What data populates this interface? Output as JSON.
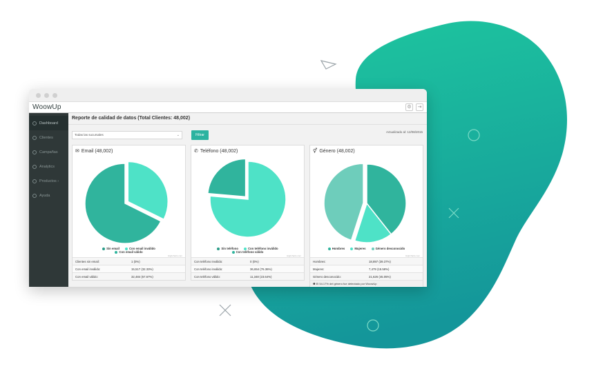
{
  "colors": {
    "teal_light": "#4ee2c7",
    "teal_mid": "#30b49d",
    "teal_pale": "#6ecdbb",
    "accent_button": "#2bb3a0",
    "sidebar_bg": "#2f3838",
    "blob_top": "#1ec79f",
    "blob_bottom": "#14969a"
  },
  "app": {
    "logo": "WoowUp"
  },
  "sidebar": {
    "items": [
      {
        "label": "Dashboard",
        "icon": "dashboard-icon"
      },
      {
        "label": "Clientes",
        "icon": "users-icon"
      },
      {
        "label": "Campañas",
        "icon": "megaphone-icon"
      },
      {
        "label": "Analytics",
        "icon": "analytics-icon"
      },
      {
        "label": "Productos ›",
        "icon": "products-icon"
      },
      {
        "label": "Ayuda",
        "icon": "help-icon"
      }
    ]
  },
  "page": {
    "title": "Reporte de calidad de datos (Total Clientes: 48,002)",
    "select_value": "Todas las sucursales",
    "filter_label": "Filtrar",
    "updated": "Actualizado al: 12/08/2015"
  },
  "panels": [
    {
      "title": "Email (48,002)",
      "icon": "envelope-icon",
      "icon_glyph": "✉",
      "legend": [
        "Sin email",
        "Con email inválido",
        "Con email válido"
      ],
      "rows": [
        {
          "label": "Clientes sin email:",
          "value": "1 (0%)"
        },
        {
          "label": "Con email inválido:",
          "value": "15,517 (32.33%)"
        },
        {
          "label": "Con email válido:",
          "value": "32,484 (67.67%)"
        }
      ],
      "credit": "Highcharts.com"
    },
    {
      "title": "Teléfono (48,002)",
      "icon": "phone-icon",
      "icon_glyph": "✆",
      "legend": [
        "Sin teléfono",
        "Con teléfono inválido",
        "Con teléfono válido"
      ],
      "rows": [
        {
          "label": "Con teléfono inválido:",
          "value": "0 (0%)"
        },
        {
          "label": "Con teléfono inválido:",
          "value": "36,654 (76.36%)"
        },
        {
          "label": "Con teléfono válido:",
          "value": "11,348 (23.64%)"
        }
      ],
      "credit": "Highcharts.com"
    },
    {
      "title": "Género (48,002)",
      "icon": "gender-icon",
      "icon_glyph": "⚥",
      "legend": [
        "Hombres",
        "Mujeres",
        "Género desconocido"
      ],
      "rows": [
        {
          "label": "Hombres:",
          "value": "18,897 (39.37%)"
        },
        {
          "label": "Mujeres:",
          "value": "7,479 (15.58%)"
        },
        {
          "label": "Género desconocido:",
          "value": "21,626 (45.05%)"
        }
      ],
      "note": "❶ El 54.17% del género fue detectado por WoowUp",
      "credit": "Highcharts.com"
    }
  ],
  "chart_data": [
    {
      "type": "pie",
      "title": "Email (48,002)",
      "categories": [
        "Sin email",
        "Con email inválido",
        "Con email válido"
      ],
      "values": [
        1,
        15517,
        32484
      ],
      "colors": [
        "#2a9c88",
        "#4ee2c7",
        "#30b49d"
      ]
    },
    {
      "type": "pie",
      "title": "Teléfono (48,002)",
      "categories": [
        "Sin teléfono",
        "Con teléfono inválido",
        "Con teléfono válido"
      ],
      "values": [
        0,
        36654,
        11348
      ],
      "colors": [
        "#2a9c88",
        "#4ee2c7",
        "#30b49d"
      ]
    },
    {
      "type": "pie",
      "title": "Género (48,002)",
      "categories": [
        "Hombres",
        "Mujeres",
        "Género desconocido"
      ],
      "values": [
        18897,
        7479,
        21626
      ],
      "colors": [
        "#30b49d",
        "#4ee2c7",
        "#6ecdbb"
      ]
    }
  ]
}
